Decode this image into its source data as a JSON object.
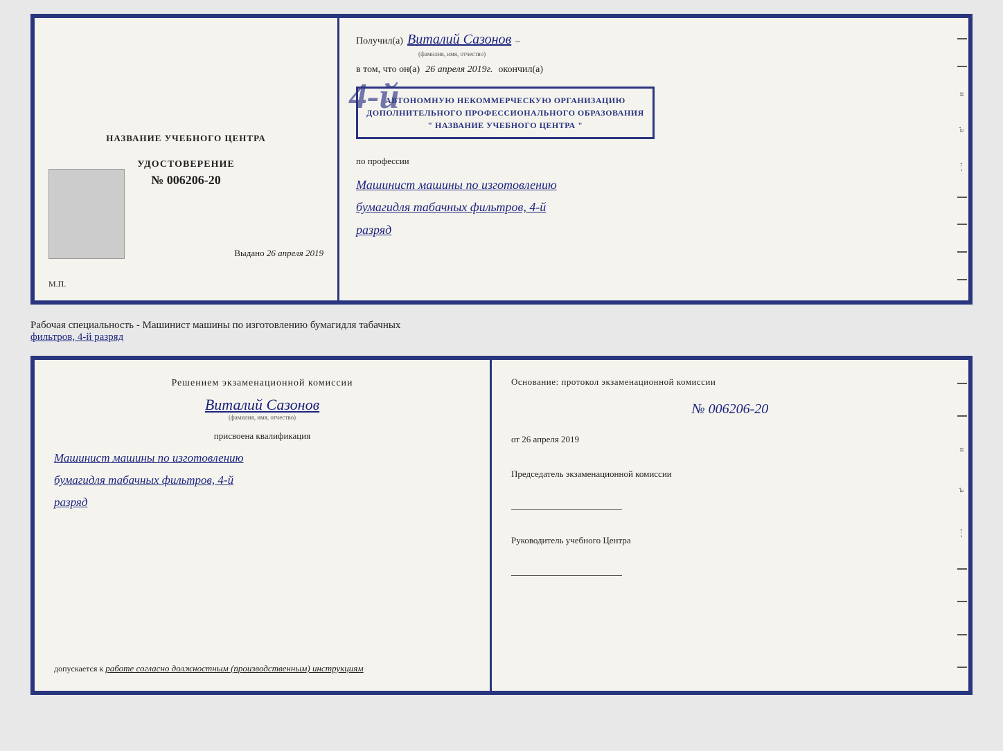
{
  "top_cert": {
    "left": {
      "title": "НАЗВАНИЕ УЧЕБНОГО ЦЕНТРА",
      "udost_label": "УДОСТОВЕРЕНИЕ",
      "udost_num": "№ 006206-20",
      "vydano_label": "Выдано",
      "vydano_date": "26 апреля 2019",
      "mp_label": "М.П."
    },
    "right": {
      "poluchil_label": "Получил(а)",
      "recipient_name": "Виталий Сазонов",
      "recipient_name_caption": "(фамилия, имя, отчество)",
      "v_tom_chto": "в том, что он(а)",
      "date_handwritten": "26 апреля 2019г.",
      "okoncil_label": "окончил(а)",
      "big_number": "4-й",
      "stamp_line1": "АВТОНОМНУЮ НЕКОММЕРЧЕСКУЮ ОРГАНИЗАЦИЮ",
      "stamp_line2": "ДОПОЛНИТЕЛЬНОГО ПРОФЕССИОНАЛЬНОГО ОБРАЗОВАНИЯ",
      "stamp_line3": "\" НАЗВАНИЕ УЧЕБНОГО ЦЕНТРА \"",
      "po_professii": "по профессии",
      "prof_line1": "Машинист машины по изготовлению",
      "prof_line2": "бумагидля табачных фильтров, 4-й",
      "prof_line3": "разряд"
    }
  },
  "separator": {
    "text": "Рабочая специальность - Машинист машины по изготовлению бумагидля табачных",
    "text2": "фильтров, 4-й разряд"
  },
  "bottom_cert": {
    "left": {
      "resheniyem": "Решением  экзаменационной  комиссии",
      "name": "Виталий Сазонов",
      "name_caption": "(фамилия, имя, отчество)",
      "prisvoena": "присвоена квалификация",
      "qual_line1": "Машинист машины по изготовлению",
      "qual_line2": "бумагидля табачных фильтров, 4-й",
      "qual_line3": "разряд",
      "dopuskaetsya": "допускается к",
      "work_note": "работе согласно должностным (производственным) инструкциям"
    },
    "right": {
      "osnovanie": "Основание: протокол экзаменационной  комиссии",
      "num": "№  006206-20",
      "ot_label": "от",
      "ot_date": "26 апреля 2019",
      "predsedatel_label": "Председатель экзаменационной комиссии",
      "rukovoditel_label": "Руководитель учебного Центра"
    }
  }
}
